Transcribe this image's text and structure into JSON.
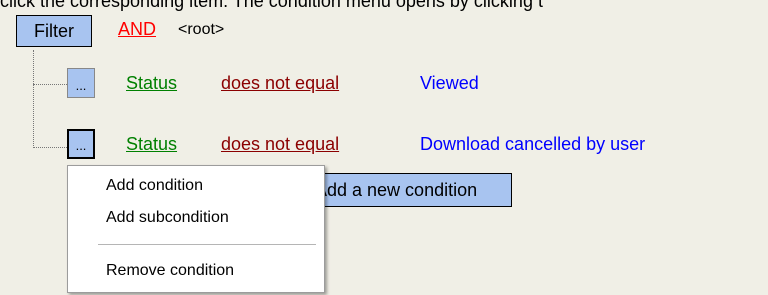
{
  "top_text": "click the corresponding item. The condition menu opens by clicking t",
  "filter": {
    "label": "Filter",
    "operator": "AND",
    "root": "<root>"
  },
  "conditions": [
    {
      "button": "...",
      "field": "Status",
      "operator": "does not equal",
      "value": "Viewed"
    },
    {
      "button": "...",
      "field": "Status",
      "operator": "does not equal",
      "value": "Download cancelled by user"
    }
  ],
  "add_condition_button": "Add a new condition",
  "context_menu": {
    "items": [
      "Add condition",
      "Add subcondition",
      "Remove condition"
    ]
  }
}
